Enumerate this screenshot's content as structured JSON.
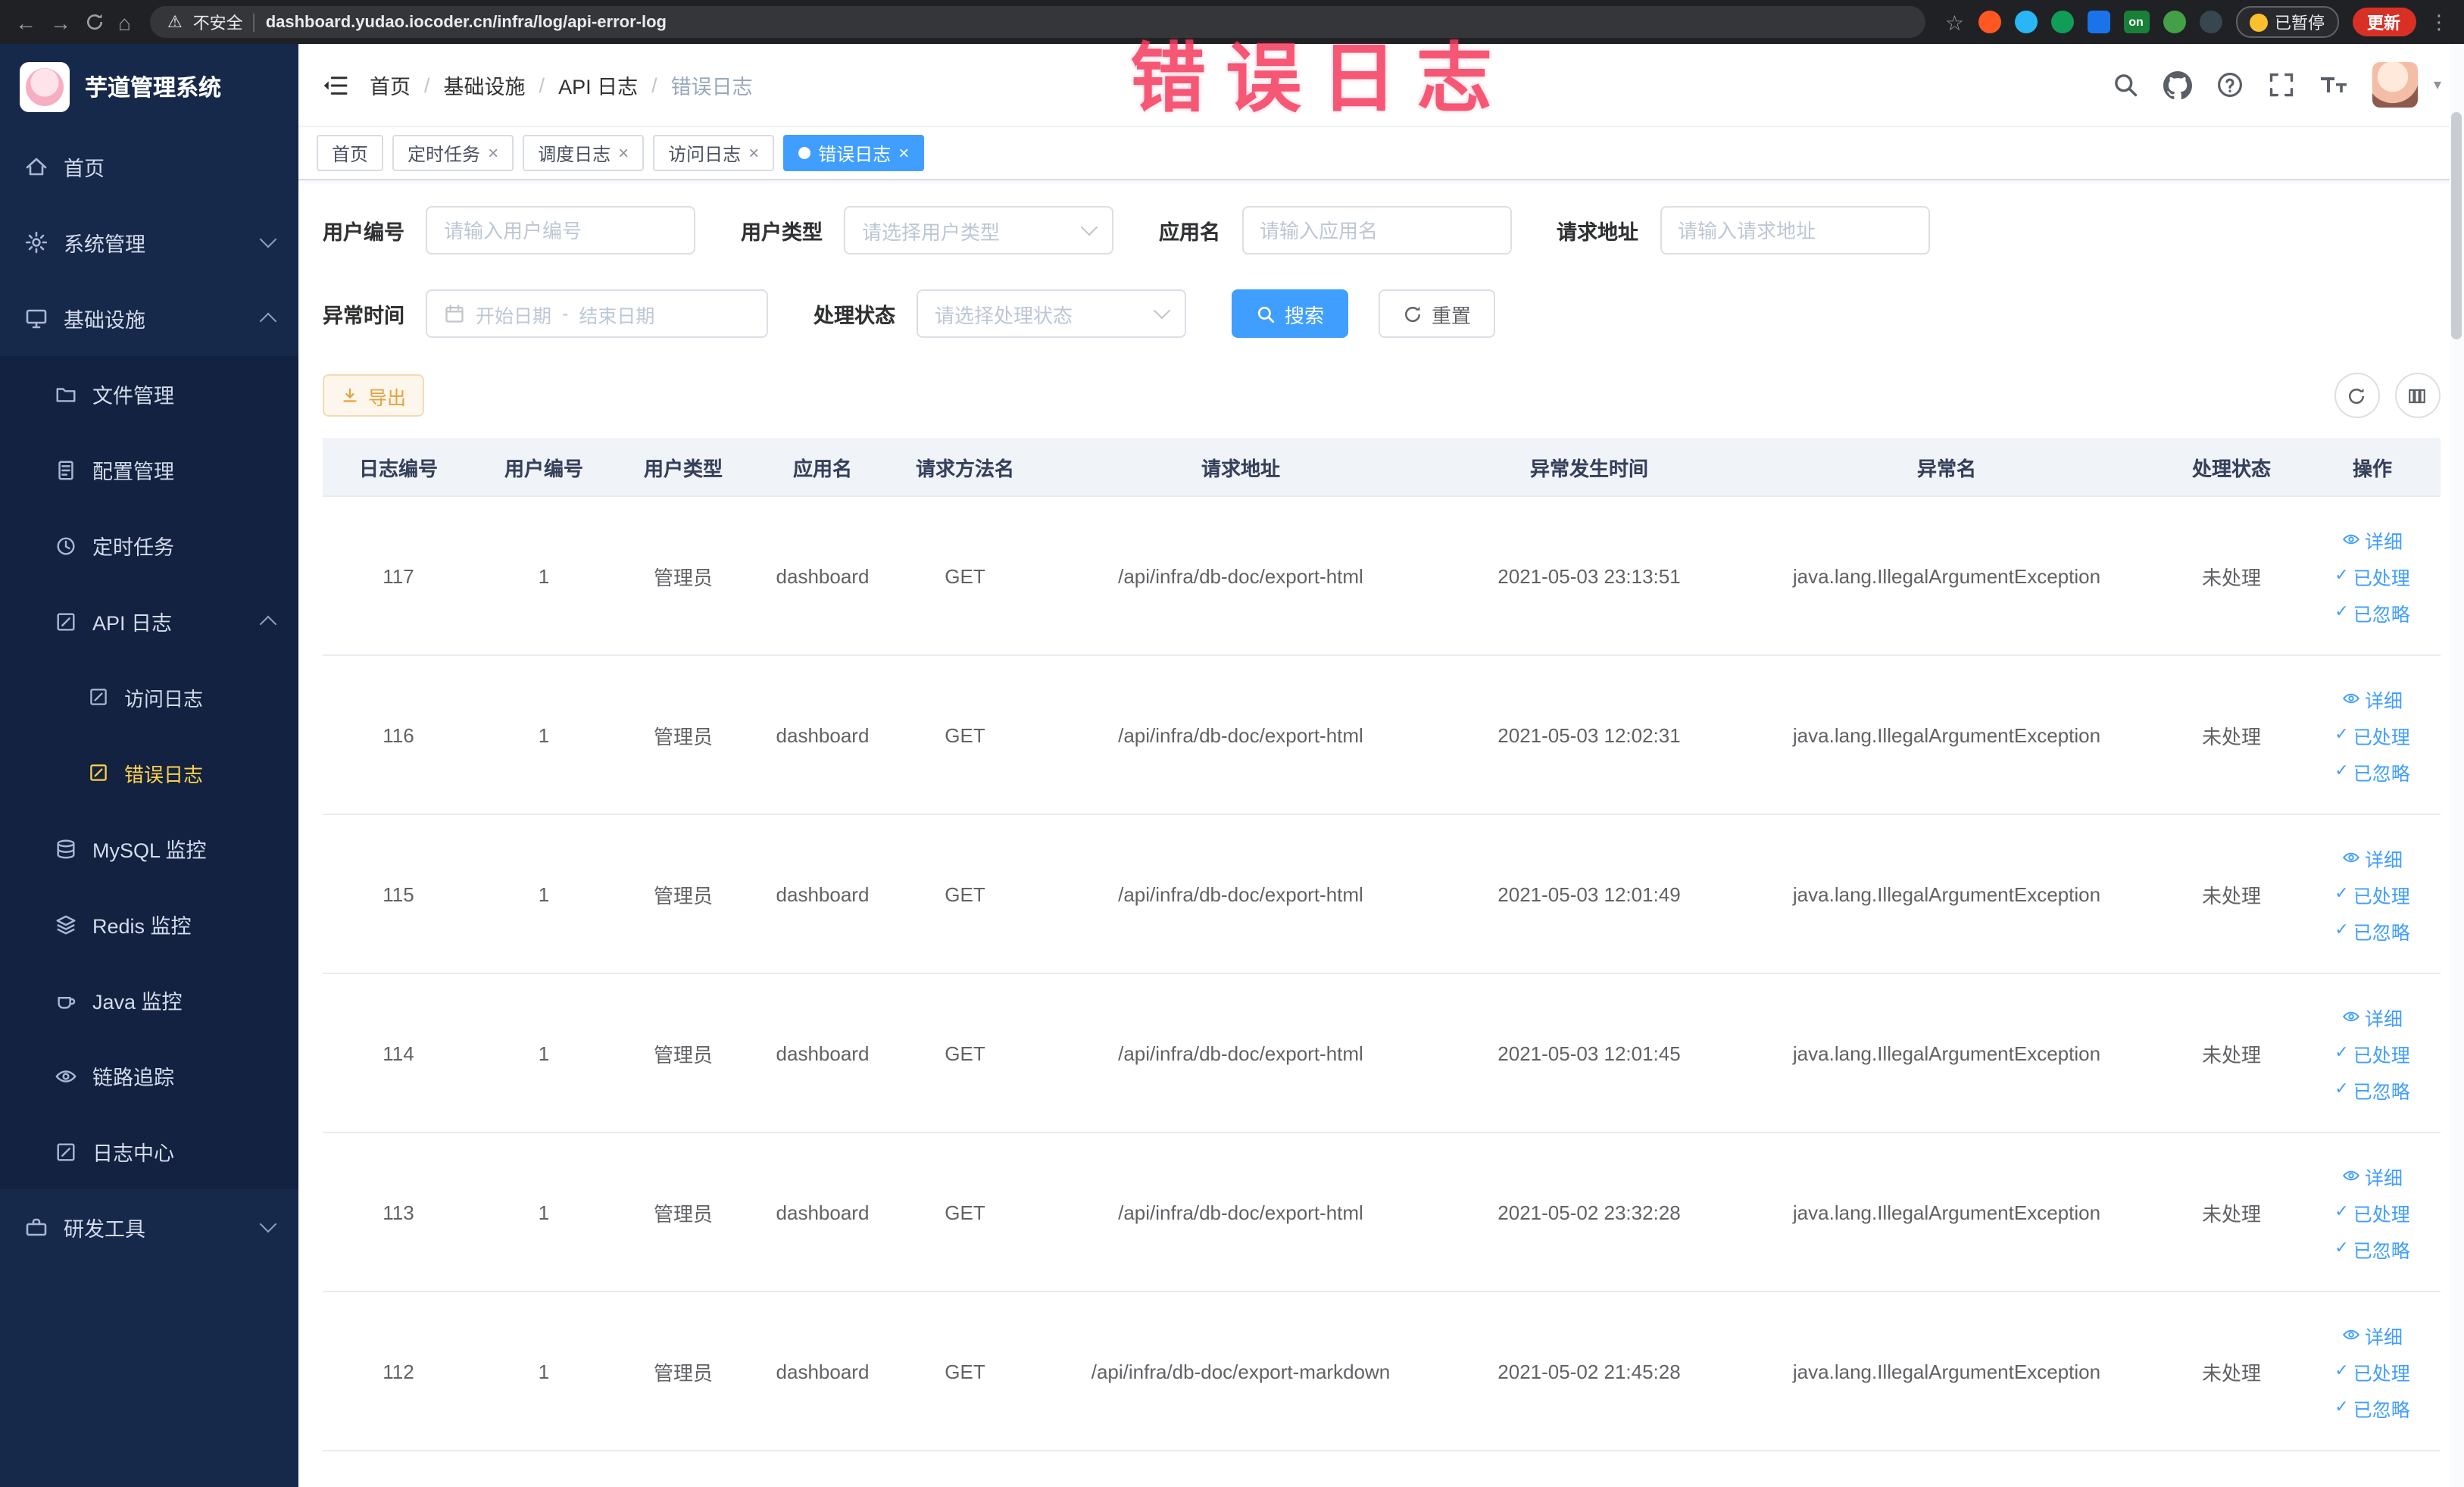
{
  "colors": {
    "accent": "#409eff",
    "sidebar_active": "#ffd04b",
    "overlay_red": "#f43a5e",
    "warning": "#e6a23c"
  },
  "icons": {
    "back": "←",
    "forward": "→",
    "home": "⌂",
    "warning": "⚠",
    "star": "☆",
    "dots": "⋮",
    "close": "×",
    "check": "✓",
    "caret": "▾"
  },
  "overlay": {
    "text": "错误日志"
  },
  "browser": {
    "not_secure_label": "不安全",
    "url": "dashboard.yudao.iocoder.cn/infra/log/api-error-log",
    "paused_badge": "已暂停",
    "update_button": "更新",
    "on_badge": "on"
  },
  "sidebar": {
    "title": "芋道管理系统",
    "home": "首页",
    "system": "系统管理",
    "infra": "基础设施",
    "file": "文件管理",
    "config": "配置管理",
    "job": "定时任务",
    "api_log": "API 日志",
    "access_log": "访问日志",
    "error_log": "错误日志",
    "mysql": "MySQL 监控",
    "redis": "Redis 监控",
    "java": "Java 监控",
    "tracing": "链路追踪",
    "log_center": "日志中心",
    "dev_tools": "研发工具"
  },
  "header": {
    "breadcrumb": [
      "首页",
      "基础设施",
      "API 日志",
      "错误日志"
    ],
    "separator": "/"
  },
  "tags": {
    "home": "首页",
    "job": "定时任务",
    "schedule": "调度日志",
    "access": "访问日志",
    "error": "错误日志"
  },
  "filters": {
    "user_id": {
      "label": "用户编号",
      "placeholder": "请输入用户编号"
    },
    "user_type": {
      "label": "用户类型",
      "placeholder": "请选择用户类型"
    },
    "app_name": {
      "label": "应用名",
      "placeholder": "请输入应用名"
    },
    "request_url": {
      "label": "请求地址",
      "placeholder": "请输入请求地址"
    },
    "exception_time": {
      "label": "异常时间",
      "start_placeholder": "开始日期",
      "end_placeholder": "结束日期",
      "separator": "-"
    },
    "process_status": {
      "label": "处理状态",
      "placeholder": "请选择处理状态"
    },
    "search_button": "搜索",
    "reset_button": "重置"
  },
  "toolbar": {
    "export_label": "导出"
  },
  "table": {
    "columns": [
      "日志编号",
      "用户编号",
      "用户类型",
      "应用名",
      "请求方法名",
      "请求地址",
      "异常发生时间",
      "异常名",
      "处理状态",
      "操作"
    ],
    "actions": {
      "detail": "详细",
      "processed": "已处理",
      "ignored": "已忽略"
    },
    "rows": [
      {
        "id": "117",
        "user_id": "1",
        "user_type": "管理员",
        "app": "dashboard",
        "method": "GET",
        "url": "/api/infra/db-doc/export-html",
        "time": "2021-05-03 23:13:51",
        "exception": "java.lang.IllegalArgumentException",
        "status": "未处理"
      },
      {
        "id": "116",
        "user_id": "1",
        "user_type": "管理员",
        "app": "dashboard",
        "method": "GET",
        "url": "/api/infra/db-doc/export-html",
        "time": "2021-05-03 12:02:31",
        "exception": "java.lang.IllegalArgumentException",
        "status": "未处理"
      },
      {
        "id": "115",
        "user_id": "1",
        "user_type": "管理员",
        "app": "dashboard",
        "method": "GET",
        "url": "/api/infra/db-doc/export-html",
        "time": "2021-05-03 12:01:49",
        "exception": "java.lang.IllegalArgumentException",
        "status": "未处理"
      },
      {
        "id": "114",
        "user_id": "1",
        "user_type": "管理员",
        "app": "dashboard",
        "method": "GET",
        "url": "/api/infra/db-doc/export-html",
        "time": "2021-05-03 12:01:45",
        "exception": "java.lang.IllegalArgumentException",
        "status": "未处理"
      },
      {
        "id": "113",
        "user_id": "1",
        "user_type": "管理员",
        "app": "dashboard",
        "method": "GET",
        "url": "/api/infra/db-doc/export-html",
        "time": "2021-05-02 23:32:28",
        "exception": "java.lang.IllegalArgumentException",
        "status": "未处理"
      },
      {
        "id": "112",
        "user_id": "1",
        "user_type": "管理员",
        "app": "dashboard",
        "method": "GET",
        "url": "/api/infra/db-doc/export-markdown",
        "time": "2021-05-02 21:45:28",
        "exception": "java.lang.IllegalArgumentException",
        "status": "未处理"
      }
    ]
  }
}
